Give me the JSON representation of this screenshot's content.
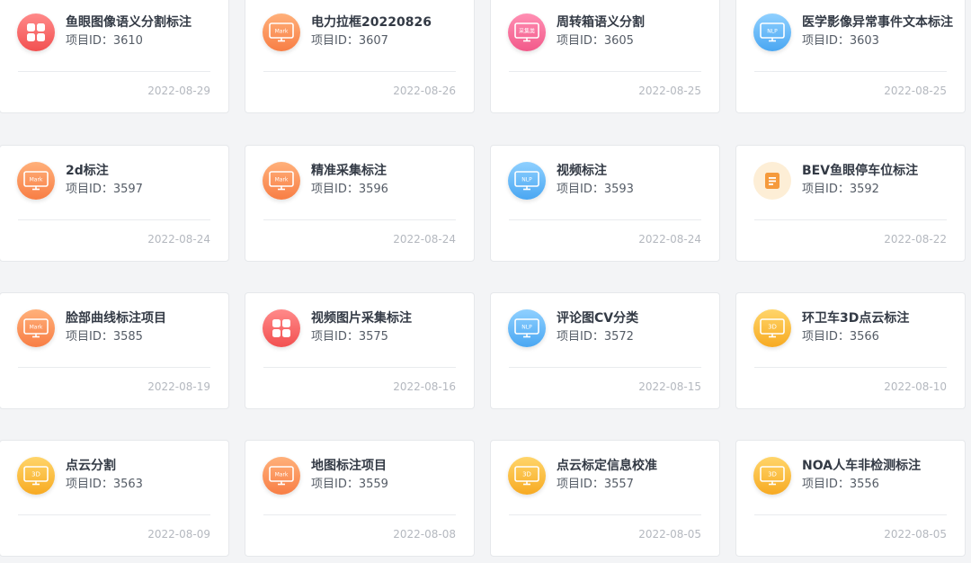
{
  "id_label": "项目ID：",
  "cards": [
    {
      "title": "鱼眼图像语义分割标注",
      "id": "3610",
      "date": "2022-08-29",
      "icon": "grid-icon",
      "color": "#f25050"
    },
    {
      "title": "电力拉框20220826",
      "id": "3607",
      "date": "2022-08-26",
      "icon": "mark-icon",
      "color": "#f87e45",
      "icon_text": "Mark"
    },
    {
      "title": "周转箱语义分割",
      "id": "3605",
      "date": "2022-08-25",
      "icon": "collect-icon",
      "color": "#f2598a",
      "icon_text": "采集类"
    },
    {
      "title": "医学影像异常事件文本标注",
      "id": "3603",
      "date": "2022-08-25",
      "icon": "nlp-icon",
      "color": "#4aa7f2",
      "icon_text": "NLP"
    },
    {
      "title": "2d标注",
      "id": "3597",
      "date": "2022-08-24",
      "icon": "mark-icon",
      "color": "#f87e45",
      "icon_text": "Mark"
    },
    {
      "title": "精准采集标注",
      "id": "3596",
      "date": "2022-08-24",
      "icon": "mark-icon",
      "color": "#f87e45",
      "icon_text": "Mark"
    },
    {
      "title": "视频标注",
      "id": "3593",
      "date": "2022-08-24",
      "icon": "nlp-icon",
      "color": "#4aa7f2",
      "icon_text": "NLP"
    },
    {
      "title": "BEV鱼眼停车位标注",
      "id": "3592",
      "date": "2022-08-22",
      "icon": "document-icon",
      "color": "#f59a3c"
    },
    {
      "title": "脸部曲线标注项目",
      "id": "3585",
      "date": "2022-08-19",
      "icon": "mark-icon",
      "color": "#f87e45",
      "icon_text": "Mark"
    },
    {
      "title": "视频图片采集标注",
      "id": "3575",
      "date": "2022-08-16",
      "icon": "grid-icon",
      "color": "#f25050"
    },
    {
      "title": "评论图CV分类",
      "id": "3572",
      "date": "2022-08-15",
      "icon": "nlp-icon",
      "color": "#4aa7f2",
      "icon_text": "NLP"
    },
    {
      "title": "环卫车3D点云标注",
      "id": "3566",
      "date": "2022-08-10",
      "icon": "3d-icon",
      "color": "#f7aa22",
      "icon_text": "3D"
    },
    {
      "title": "点云分割",
      "id": "3563",
      "date": "2022-08-09",
      "icon": "3d-icon",
      "color": "#f7aa22",
      "icon_text": "3D"
    },
    {
      "title": "地图标注项目",
      "id": "3559",
      "date": "2022-08-08",
      "icon": "mark-icon",
      "color": "#f87e45",
      "icon_text": "Mark"
    },
    {
      "title": "点云标定信息校准",
      "id": "3557",
      "date": "2022-08-05",
      "icon": "3d-icon",
      "color": "#f7aa22",
      "icon_text": "3D"
    },
    {
      "title": "NOA人车非检测标注",
      "id": "3556",
      "date": "2022-08-05",
      "icon": "3d-icon",
      "color": "#f7aa22",
      "icon_text": "3D"
    }
  ]
}
